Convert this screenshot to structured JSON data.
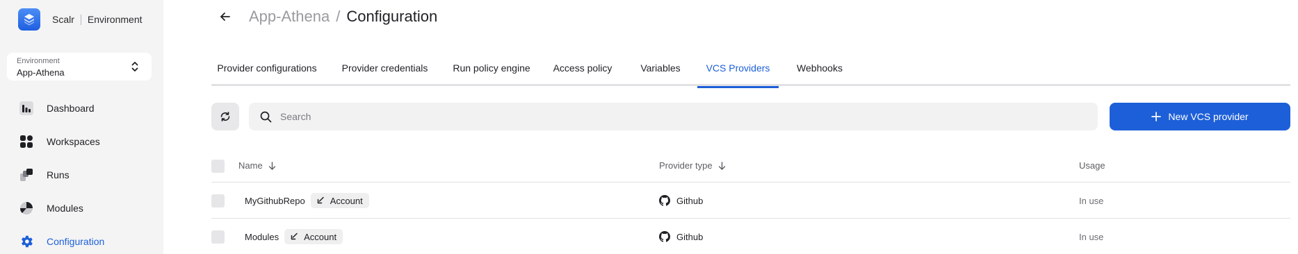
{
  "brand": {
    "name": "Scalr",
    "section": "Environment"
  },
  "environment": {
    "label": "Environment",
    "value": "App-Athena"
  },
  "sidebar": {
    "items": [
      {
        "label": "Dashboard",
        "icon": "dashboard-icon"
      },
      {
        "label": "Workspaces",
        "icon": "workspaces-icon"
      },
      {
        "label": "Runs",
        "icon": "runs-icon"
      },
      {
        "label": "Modules",
        "icon": "modules-icon"
      },
      {
        "label": "Configuration",
        "icon": "gear-icon",
        "active": true
      }
    ]
  },
  "header": {
    "breadcrumb_parent": "App-Athena",
    "separator": "/",
    "title": "Configuration"
  },
  "tabs": [
    {
      "label": "Provider configurations"
    },
    {
      "label": "Provider credentials"
    },
    {
      "label": "Run policy engine"
    },
    {
      "label": "Access policy"
    },
    {
      "label": "Variables"
    },
    {
      "label": "VCS Providers",
      "active": true
    },
    {
      "label": "Webhooks"
    }
  ],
  "toolbar": {
    "search_placeholder": "Search",
    "new_button_label": "New VCS provider"
  },
  "table": {
    "columns": {
      "name": "Name",
      "provider_type": "Provider type",
      "usage": "Usage"
    },
    "rows": [
      {
        "name": "MyGithubRepo",
        "badge": "Account",
        "provider_type": "Github",
        "usage": "In use"
      },
      {
        "name": "Modules",
        "badge": "Account",
        "provider_type": "Github",
        "usage": "In use"
      }
    ]
  },
  "colors": {
    "accent": "#1d5fd8",
    "sidebar_bg": "#f4f4f4",
    "logo": "#3b7cf0"
  }
}
